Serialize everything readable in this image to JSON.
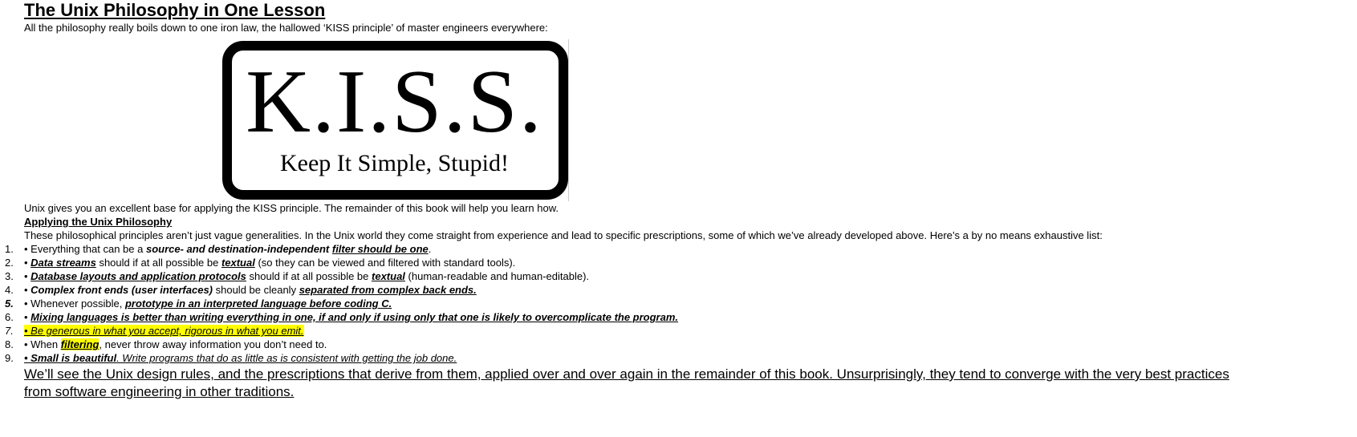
{
  "title": "The Unix Philosophy in One Lesson",
  "intro": "All the philosophy really boils down to one iron law, the hallowed ‘KISS principle’ of master engineers everywhere:",
  "image": {
    "big": "K.I.S.S.",
    "sub": "Keep It Simple, Stupid!"
  },
  "after_image": "Unix gives you an excellent base for applying the KISS principle. The remainder of this book will help you learn how.",
  "heading2": "Applying the Unix Philosophy",
  "para2": "These philosophical principles aren’t just vague generalities. In the Unix world they come straight from experience and lead to specific prescriptions, some of which we’ve already developed above. Here’s a by no means exhaustive list:",
  "items": [
    {
      "n": "1.",
      "s": [
        "• Everything that can be a ",
        "source- and destination-independent",
        " ",
        "filter should be one",
        "."
      ]
    },
    {
      "n": "2.",
      "s": [
        "• ",
        "Data streams",
        " should if at all possible be ",
        "textual",
        " (so they can be viewed and filtered with standard tools)."
      ]
    },
    {
      "n": "3.",
      "s": [
        "• ",
        "Database layouts and application protocols",
        " should if at all possible be ",
        "textual",
        " (human-readable and human-editable)."
      ]
    },
    {
      "n": "4.",
      "s": [
        "• ",
        "Complex front ends (user interfaces)",
        " should be cleanly ",
        "separated from complex back ends."
      ]
    },
    {
      "n": "5.",
      "s": [
        "• Whenever possible, ",
        "prototype in an interpreted language before coding C."
      ]
    },
    {
      "n": "6.",
      "s": [
        "• ",
        "Mixing languages is better than writing everything in one, if and only if using only that one is likely to overcomplicate the program."
      ]
    },
    {
      "n": "7.",
      "s": [
        "• Be generous in what you accept, rigorous in what you emit."
      ]
    },
    {
      "n": "8.",
      "s": [
        "• When ",
        "filtering",
        ", never throw away information you don’t need to."
      ]
    },
    {
      "n": "9.",
      "s": [
        "• Small is beautiful",
        ". Write programs that do as little as is consistent with getting the job done."
      ]
    }
  ],
  "closing": "We’ll see the Unix design rules, and the prescriptions that derive from them, applied over and over again in the remainder of this book. Unsurprisingly, they tend to converge with the very best practices from software engineering in other traditions."
}
